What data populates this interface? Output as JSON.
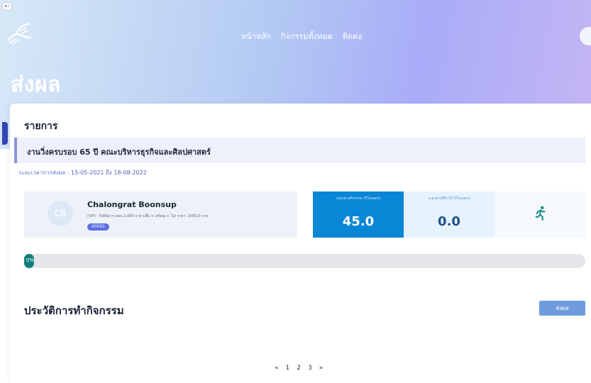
{
  "browser": {
    "tab_glyph": "◂ ›"
  },
  "header": {
    "nav": [
      {
        "label": "หน้าหลัก"
      },
      {
        "label": "กิจกรรมทั้งหมด"
      },
      {
        "label": "ติดต่อ"
      }
    ],
    "page_title": "ส่งผล"
  },
  "main": {
    "section_label": "รายการ",
    "event_title": "งานวิ่งครบรอบ 65 ปี คณะบริหารธุรกิจและศิลปศาสตร์",
    "period_label": "ระยะเวลาการส่งผล : ",
    "period_dates": "15-05-2021 ถึง 18-08-2022",
    "runner": {
      "initials": "CB",
      "name": "Chalongrat Boonsup",
      "detail": "(VIP) : วิ่งมินิมาราธอน 1,000 บาท (เสื้อ + เหรียญ + โล่) ราคา: 1000.0 บาท",
      "bib": "00001"
    },
    "stats": {
      "total_label": "ระยะทางกิจกรรม (กิโลเมตร)",
      "total_value": "45.0",
      "done_label": "ระยะทางที่ทำได้ (กิโลเมตร)",
      "done_value": "0.0"
    },
    "progress": {
      "percent": 0,
      "text": "0%"
    },
    "history_title": "ประวัติการทำกิจกรรม",
    "submit_label": "ส่งผล",
    "pagination": [
      "«",
      "1",
      "2",
      "3",
      "»"
    ]
  },
  "colors": {
    "accent": "#3346b4",
    "stat_total": "#0a86d6",
    "progress_fill": "#117f7c",
    "button": "#6f9cdd"
  },
  "icons": {
    "logo": "running-shoe-logo-icon",
    "runner": "running-person-icon"
  }
}
